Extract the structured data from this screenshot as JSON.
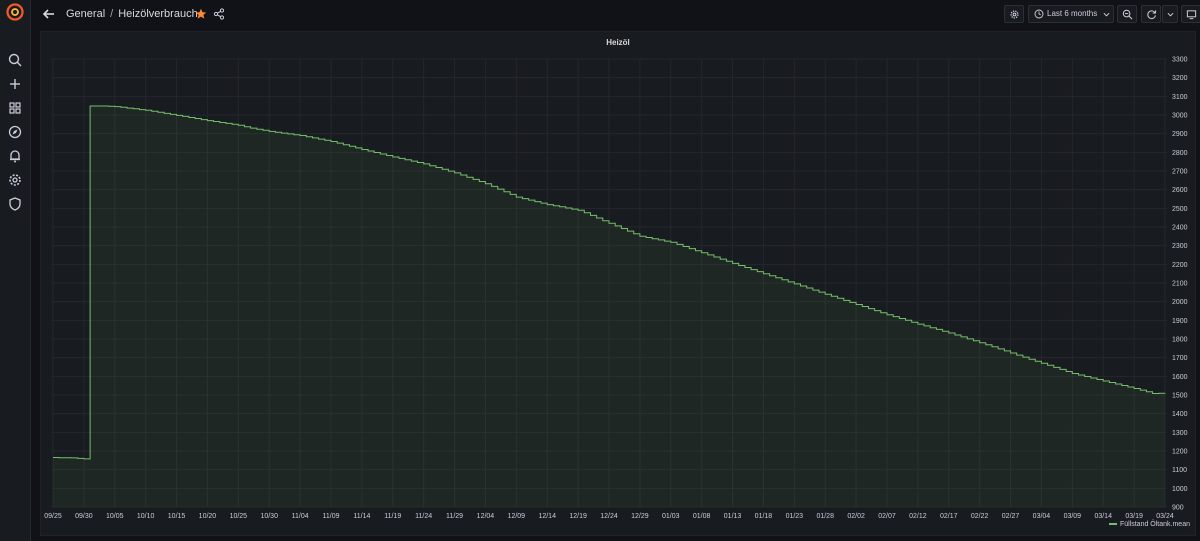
{
  "header": {
    "breadcrumb_folder": "General",
    "breadcrumb_separator": "/",
    "dashboard_title": "Heizölverbrauch",
    "time_range": "Last 6 months"
  },
  "icons": {
    "logo": "grafana-logo-icon",
    "sidebar": [
      "search-icon",
      "plus-icon",
      "dashboards-icon",
      "explore-icon",
      "alerting-icon",
      "gear-icon",
      "shield-icon"
    ]
  },
  "colors": {
    "series": "#73bf69",
    "star": "#ff8833",
    "background": "#111217",
    "panel": "#181b1f"
  },
  "panel": {
    "title": "Heizöl"
  },
  "chart_data": {
    "type": "area",
    "title": "Heizöl",
    "xlabel": "",
    "ylabel": "",
    "y_axis_position": "right",
    "ylim": [
      900,
      3300
    ],
    "y_ticks": [
      900,
      1000,
      1100,
      1200,
      1300,
      1400,
      1500,
      1600,
      1700,
      1800,
      1900,
      2000,
      2100,
      2200,
      2300,
      2400,
      2500,
      2600,
      2700,
      2800,
      2900,
      3000,
      3100,
      3200,
      3300
    ],
    "x_ticks": [
      "09/25",
      "09/30",
      "10/05",
      "10/10",
      "10/15",
      "10/20",
      "10/25",
      "10/30",
      "11/04",
      "11/09",
      "11/14",
      "11/19",
      "11/24",
      "11/29",
      "12/04",
      "12/09",
      "12/14",
      "12/19",
      "12/24",
      "12/29",
      "01/03",
      "01/08",
      "01/13",
      "01/18",
      "01/23",
      "01/28",
      "02/02",
      "02/07",
      "02/12",
      "02/17",
      "02/22",
      "02/27",
      "03/04",
      "03/09",
      "03/14",
      "03/19",
      "03/24"
    ],
    "grid": true,
    "legend_position": "bottom-right",
    "series": [
      {
        "name": "Füllstand Öltank.mean",
        "points": [
          {
            "x": "09/25",
            "y": 1165
          },
          {
            "x": "09/28",
            "y": 1163
          },
          {
            "x": "10/01",
            "y": 1155
          },
          {
            "x": "10/01",
            "y": 3048
          },
          {
            "x": "10/03",
            "y": 3048
          },
          {
            "x": "10/05",
            "y": 3045
          },
          {
            "x": "10/10",
            "y": 3025
          },
          {
            "x": "10/15",
            "y": 2998
          },
          {
            "x": "10/20",
            "y": 2970
          },
          {
            "x": "10/25",
            "y": 2945
          },
          {
            "x": "10/27",
            "y": 2930
          },
          {
            "x": "10/30",
            "y": 2912
          },
          {
            "x": "11/04",
            "y": 2890
          },
          {
            "x": "11/09",
            "y": 2858
          },
          {
            "x": "11/14",
            "y": 2815
          },
          {
            "x": "11/19",
            "y": 2775
          },
          {
            "x": "11/24",
            "y": 2738
          },
          {
            "x": "11/29",
            "y": 2690
          },
          {
            "x": "12/04",
            "y": 2632
          },
          {
            "x": "12/09",
            "y": 2560
          },
          {
            "x": "12/14",
            "y": 2520
          },
          {
            "x": "12/19",
            "y": 2490
          },
          {
            "x": "12/24",
            "y": 2420
          },
          {
            "x": "12/29",
            "y": 2350
          },
          {
            "x": "01/03",
            "y": 2318
          },
          {
            "x": "01/08",
            "y": 2262
          },
          {
            "x": "01/13",
            "y": 2205
          },
          {
            "x": "01/18",
            "y": 2150
          },
          {
            "x": "01/23",
            "y": 2095
          },
          {
            "x": "01/28",
            "y": 2040
          },
          {
            "x": "02/02",
            "y": 1985
          },
          {
            "x": "02/07",
            "y": 1930
          },
          {
            "x": "02/12",
            "y": 1880
          },
          {
            "x": "02/17",
            "y": 1832
          },
          {
            "x": "02/22",
            "y": 1780
          },
          {
            "x": "02/27",
            "y": 1725
          },
          {
            "x": "03/04",
            "y": 1670
          },
          {
            "x": "03/09",
            "y": 1615
          },
          {
            "x": "03/14",
            "y": 1575
          },
          {
            "x": "03/19",
            "y": 1535
          },
          {
            "x": "03/22",
            "y": 1508
          },
          {
            "x": "03/24",
            "y": 1510
          }
        ]
      }
    ]
  }
}
